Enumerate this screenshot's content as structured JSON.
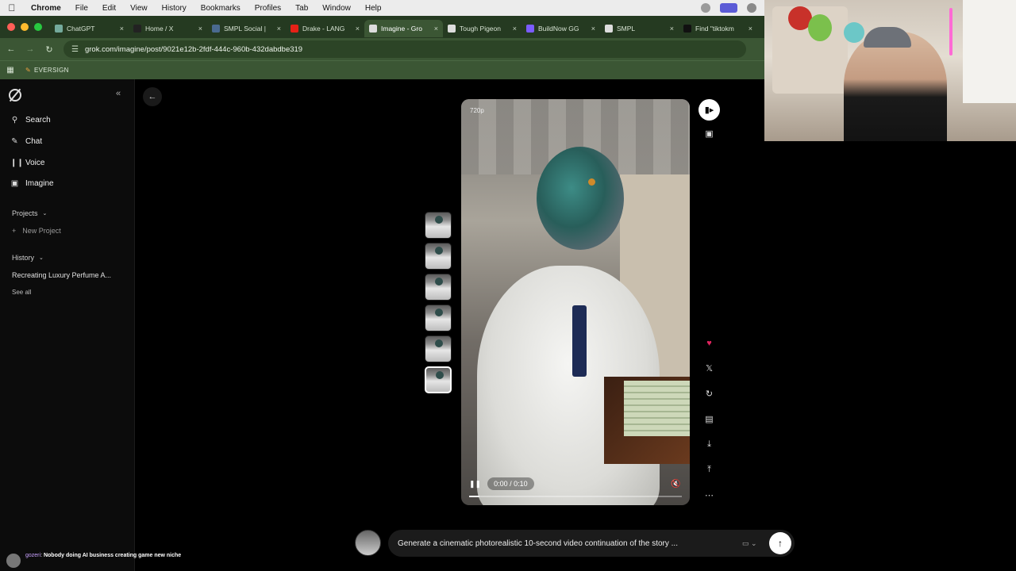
{
  "menubar": {
    "app": "Chrome",
    "items": [
      "File",
      "Edit",
      "View",
      "History",
      "Bookmarks",
      "Profiles",
      "Tab",
      "Window",
      "Help"
    ]
  },
  "tabs": [
    {
      "label": "ChatGPT",
      "color": "#74aa9c"
    },
    {
      "label": "Home / X",
      "color": "#222222"
    },
    {
      "label": "SMPL Social |",
      "color": "#4a6a90"
    },
    {
      "label": "Drake - LANG",
      "color": "#e62117"
    },
    {
      "label": "Imagine - Gro",
      "color": "#dddddd",
      "active": true
    },
    {
      "label": "Tough Pigeon",
      "color": "#dddddd"
    },
    {
      "label": "BuildNow GG",
      "color": "#7b5cff"
    },
    {
      "label": "SMPL",
      "color": "#dddddd"
    },
    {
      "label": "Find \"tiktokm",
      "color": "#111111"
    }
  ],
  "address": {
    "url": "grok.com/imagine/post/9021e12b-2fdf-444c-960b-432dabdbe319"
  },
  "bookmarks": {
    "items": [
      "EVERSIGN"
    ]
  },
  "sidebar": {
    "nav": [
      {
        "label": "Search",
        "icon": "search-icon"
      },
      {
        "label": "Chat",
        "icon": "chat-icon"
      },
      {
        "label": "Voice",
        "icon": "voice-icon"
      },
      {
        "label": "Imagine",
        "icon": "imagine-icon"
      }
    ],
    "projects_label": "Projects",
    "new_project": "New Project",
    "history_label": "History",
    "history_items": [
      "Recreating Luxury Perfume A..."
    ],
    "see_all": "See all"
  },
  "video": {
    "resolution": "720p",
    "time": "0:00 / 0:10",
    "progress": 0.05
  },
  "prompt": {
    "text": "Generate a cinematic photorealistic 10-second video continuation of the story ..."
  },
  "stream_chat": {
    "user": "gozeri",
    "message": "Nobody doing AI business creating game new niche"
  },
  "colors": {
    "accent_like": "#e0245e",
    "toolbar": "#3b5634"
  }
}
